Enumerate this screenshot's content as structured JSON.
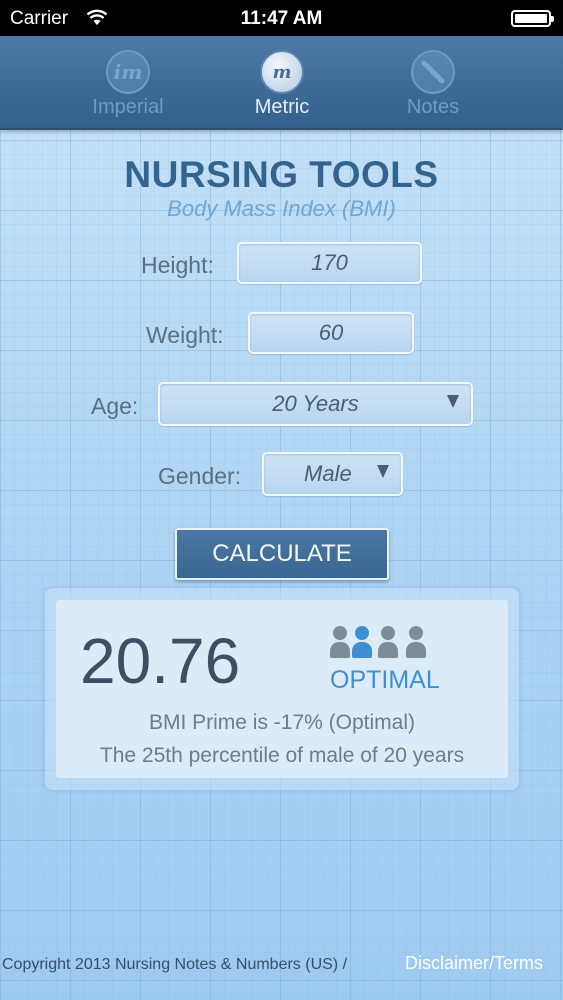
{
  "status_bar": {
    "carrier": "Carrier",
    "time": "11:47 AM"
  },
  "tabs": [
    {
      "label": "Imperial",
      "icon_text": "im",
      "icon": "imperial-icon",
      "active": false
    },
    {
      "label": "Metric",
      "icon_text": "m",
      "icon": "metric-icon",
      "active": true
    },
    {
      "label": "Notes",
      "icon_text": "",
      "icon": "pencil-icon",
      "active": false
    }
  ],
  "header": {
    "title": "NURSING TOOLS",
    "subtitle": "Body Mass Index (BMI)"
  },
  "form": {
    "height_label": "Height:",
    "height_value": "170",
    "weight_label": "Weight:",
    "weight_value": "60",
    "age_label": "Age:",
    "age_value": "20 Years",
    "gender_label": "Gender:",
    "gender_value": "Male",
    "calculate_label": "CALCULATE"
  },
  "result": {
    "bmi": "20.76",
    "category": "OPTIMAL",
    "people_icons": [
      "grey",
      "blue",
      "grey",
      "grey"
    ],
    "prime_text": "BMI Prime is -17% (Optimal)",
    "percentile_text": "The 25th percentile of male of 20 years"
  },
  "footer": {
    "copyright": "Copyright 2013 Nursing Notes & Numbers (US) /",
    "link": "Disclaimer/Terms"
  },
  "colors": {
    "accent_blue": "#3d8fd2",
    "tab_bar": "#3d6b98",
    "title": "#33648f"
  }
}
